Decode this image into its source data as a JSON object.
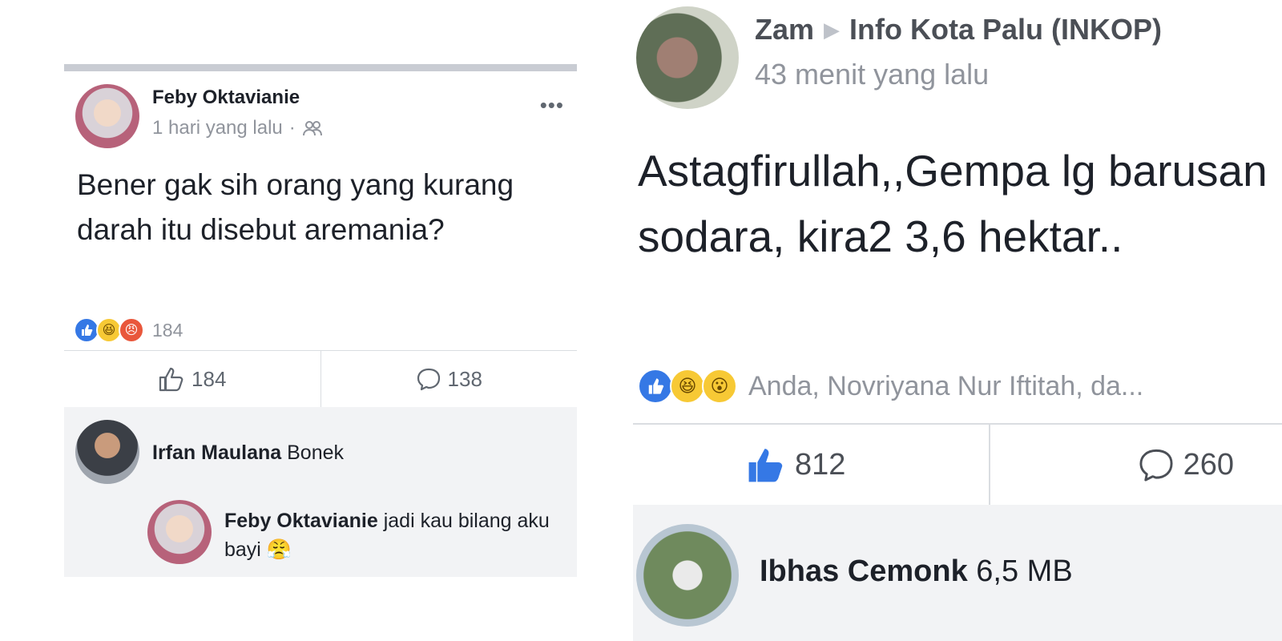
{
  "left": {
    "author": "Feby Oktavianie",
    "time": "1 hari yang lalu",
    "separator": "·",
    "more": "•••",
    "post_text": "Bener gak sih orang yang kurang darah itu disebut aremania?",
    "reaction_count": "184",
    "like_count": "184",
    "comment_count": "138",
    "comments": [
      {
        "author": "Irfan Maulana",
        "text": "Bonek"
      },
      {
        "author": "Feby Oktavianie",
        "text": "jadi kau bilang aku bayi 😤"
      }
    ]
  },
  "right": {
    "author": "Zam",
    "arrow": "▶",
    "group": "Info Kota Palu (INKOP)",
    "time": "43 menit yang lalu",
    "post_text": "Astagfirullah,,Gempa lg barusan sodara, kira2 3,6 hektar..",
    "reaction_names": "Anda, Novriyana Nur Iftitah, da...",
    "like_count": "812",
    "comment_count": "260",
    "comment": {
      "author": "Ibhas Cemonk",
      "text": "6,5 MB"
    }
  },
  "icons": {
    "like": "👍",
    "haha": "😆",
    "angry": "😠",
    "wow": "😮",
    "comment": "💬",
    "friends": "👥"
  }
}
